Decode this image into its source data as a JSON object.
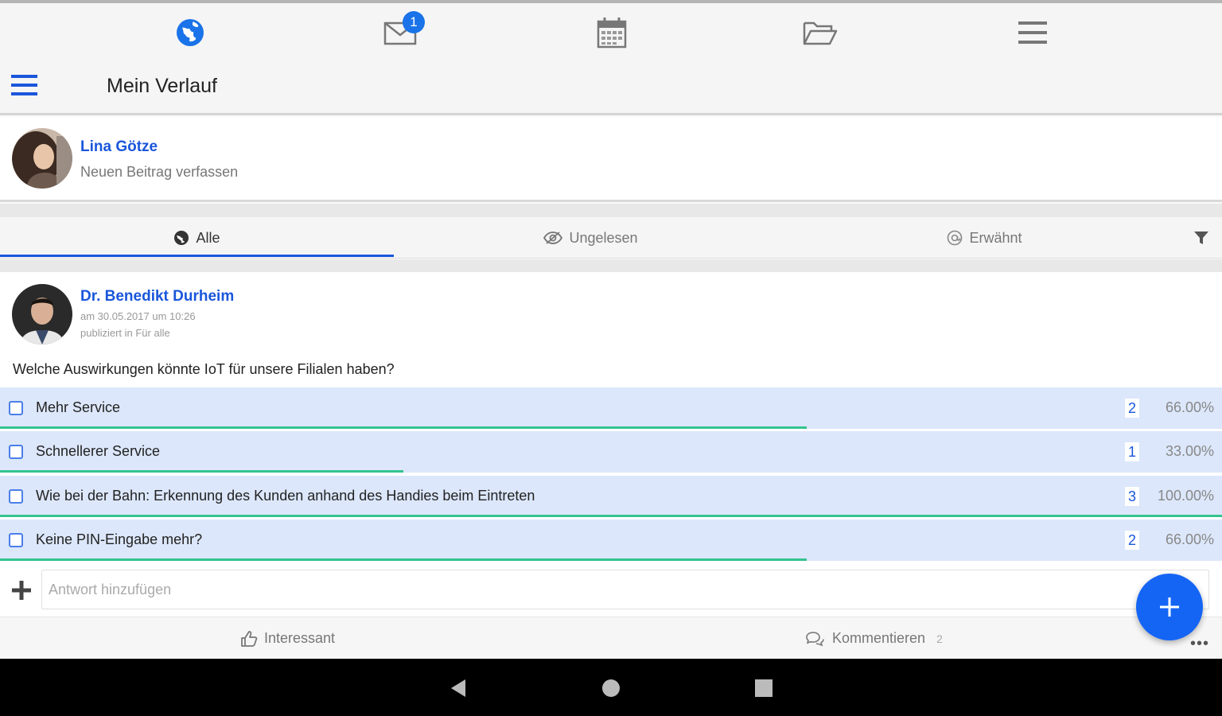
{
  "topbar": {
    "icons": [
      "globe-icon",
      "mail-icon",
      "calendar-icon",
      "folder-icon",
      "menu-icon"
    ],
    "mail_badge": "1",
    "accent": "#1a73e8"
  },
  "header": {
    "title": "Mein Verlauf"
  },
  "compose": {
    "user": "Lina Götze",
    "prompt": "Neuen Beitrag verfassen"
  },
  "tabs": [
    {
      "label": "Alle",
      "icon": "globe-icon",
      "active": true
    },
    {
      "label": "Ungelesen",
      "icon": "eye-slash-icon",
      "active": false
    },
    {
      "label": "Erwähnt",
      "icon": "at-icon",
      "active": false
    }
  ],
  "post": {
    "author": "Dr. Benedikt Durheim",
    "date": "am 30.05.2017 um 10:26",
    "published": "publiziert in Für alle",
    "question": "Welche Auswirkungen könnte IoT für unsere Filialen haben?",
    "options": [
      {
        "label": "Mehr Service",
        "count": "2",
        "percent": "66.00%",
        "fraction": 0.66
      },
      {
        "label": "Schnellerer Service",
        "count": "1",
        "percent": "33.00%",
        "fraction": 0.33
      },
      {
        "label": "Wie bei der Bahn: Erkennung des Kunden anhand des Handies beim Eintreten",
        "count": "3",
        "percent": "100.00%",
        "fraction": 1.0
      },
      {
        "label": "Keine PIN-Eingabe mehr?",
        "count": "2",
        "percent": "66.00%",
        "fraction": 0.66
      }
    ],
    "reply_placeholder": "Antwort hinzufügen",
    "actions": {
      "like": "Interessant",
      "comment": "Kommentieren",
      "comment_count": "2"
    }
  },
  "colors": {
    "link": "#1a56db",
    "bar": "#34c38f",
    "option_bg": "#dce7fb",
    "fab": "#1565f5"
  }
}
